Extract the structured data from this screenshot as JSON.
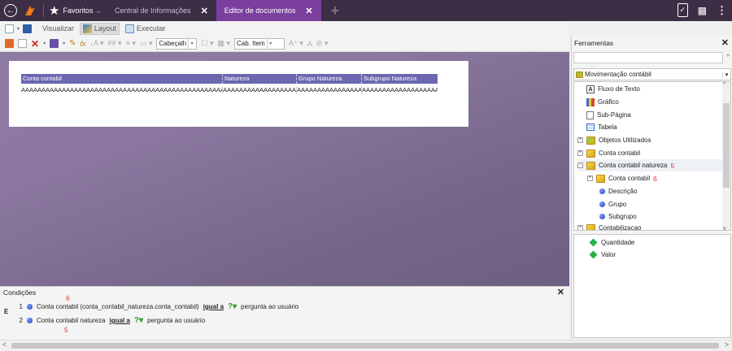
{
  "titlebar": {
    "favorites_label": "Favoritos",
    "tabs": [
      {
        "label": "Central de Informações",
        "active": false
      },
      {
        "label": "Editor de documentos",
        "active": true
      }
    ]
  },
  "toolbar1": {
    "view_label": "Visualizar",
    "layout_label": "Layout",
    "execute_label": "Executar"
  },
  "toolbar2": {
    "font_combo": "Cabeçalh",
    "style_combo": "Cab. Item"
  },
  "report": {
    "headers": [
      "Conta contabil",
      "Natureza",
      "Grupo Natureza",
      "Subgrupo Natureza"
    ],
    "row": [
      "AAAAAAAAAAAAAAAAAAAAAAAAAAAAAAAAAAAAAAAAAAAAAAAAAAAAA",
      "AAAAAAAAAAAAAAAAAAAAAAAA",
      "AAAAAAAAAAAAAAAAAAAAAA",
      "AAAAAAAAAAAAAAAAAAAAAAAA"
    ]
  },
  "conditions": {
    "title": "Condições",
    "annotation_top": "6",
    "connector": "E",
    "rows": [
      {
        "num": "1",
        "field": "Conta contabil (conta_contabil_natureza.conta_contabil)",
        "op": "igual a",
        "value": "pergunta ao usuário"
      },
      {
        "num": "2",
        "field": "Conta contabil natureza",
        "op": "igual a",
        "value": "pergunta ao usuário",
        "annotation": "5"
      }
    ]
  },
  "tools": {
    "title": "Ferramentas",
    "selected": "Movimentação contábil",
    "tree": [
      {
        "label": "Fluxo de Texto",
        "icon": "text-icon"
      },
      {
        "label": "Gráfico",
        "icon": "chart-icon"
      },
      {
        "label": "Sub-Página",
        "icon": "page-icon"
      },
      {
        "label": "Tabela",
        "icon": "table-icon"
      },
      {
        "label": "Objetos Utilizados",
        "icon": "cube-icon"
      },
      {
        "label": "Conta contabil",
        "icon": "cube-icon"
      },
      {
        "label": "Conta contabil natureza",
        "icon": "cube-icon",
        "annotation": "5"
      },
      {
        "label": "Conta contabil",
        "icon": "cube-icon",
        "annotation": "6"
      },
      {
        "label": "Descrição",
        "icon": "field-icon"
      },
      {
        "label": "Grupo",
        "icon": "field-icon"
      },
      {
        "label": "Subgrupo",
        "icon": "field-icon"
      },
      {
        "label": "Contabilizacao",
        "icon": "cube-icon"
      }
    ],
    "metrics": [
      "Quantidade",
      "Valor"
    ]
  },
  "colors": {
    "accent": "#7b3f9e",
    "titlebar": "#3b2e45",
    "band": "#6b68b0",
    "annotation": "#e03030"
  }
}
